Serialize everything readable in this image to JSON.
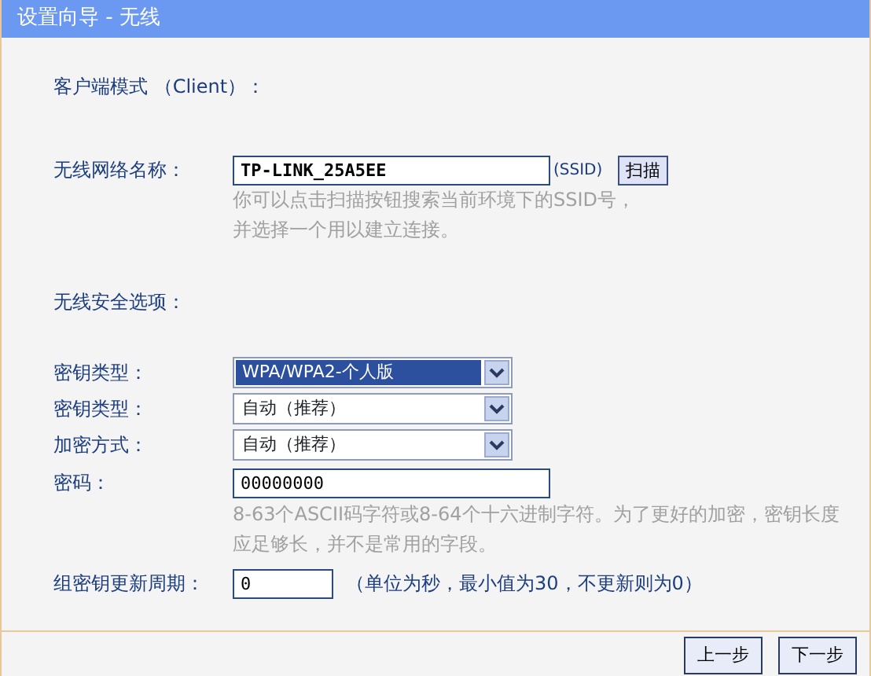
{
  "window": {
    "title": "设置向导 - 无线"
  },
  "mode_heading": "客户端模式 （Client）：",
  "ssid": {
    "label": "无线网络名称：",
    "value": "TP-LINK_25A5EE",
    "suffix": "(SSID)",
    "scan_button": "扫描",
    "hint": [
      "你可以点击扫描按钮搜索当前环境下的SSID号，",
      "并选择一个用以建立连接。"
    ]
  },
  "security_heading": "无线安全选项：",
  "selects": [
    {
      "label": "密钥类型：",
      "value": "WPA/WPA2-个人版",
      "selected": true
    },
    {
      "label": "密钥类型：",
      "value": "自动（推荐）",
      "selected": false
    },
    {
      "label": "加密方式：",
      "value": "自动（推荐）",
      "selected": false
    }
  ],
  "password": {
    "label": "密码：",
    "value": "00000000",
    "hint": [
      "8-63个ASCII码字符或8-64个十六进制字符。为了更好的加密，密钥长度",
      "应足够长，并不是常用的字段。"
    ]
  },
  "group_key": {
    "label": "组密钥更新周期：",
    "value": "0",
    "note": "（单位为秒，最小值为30，不更新则为0）"
  },
  "buttons": [
    "上一步",
    "下一步"
  ]
}
